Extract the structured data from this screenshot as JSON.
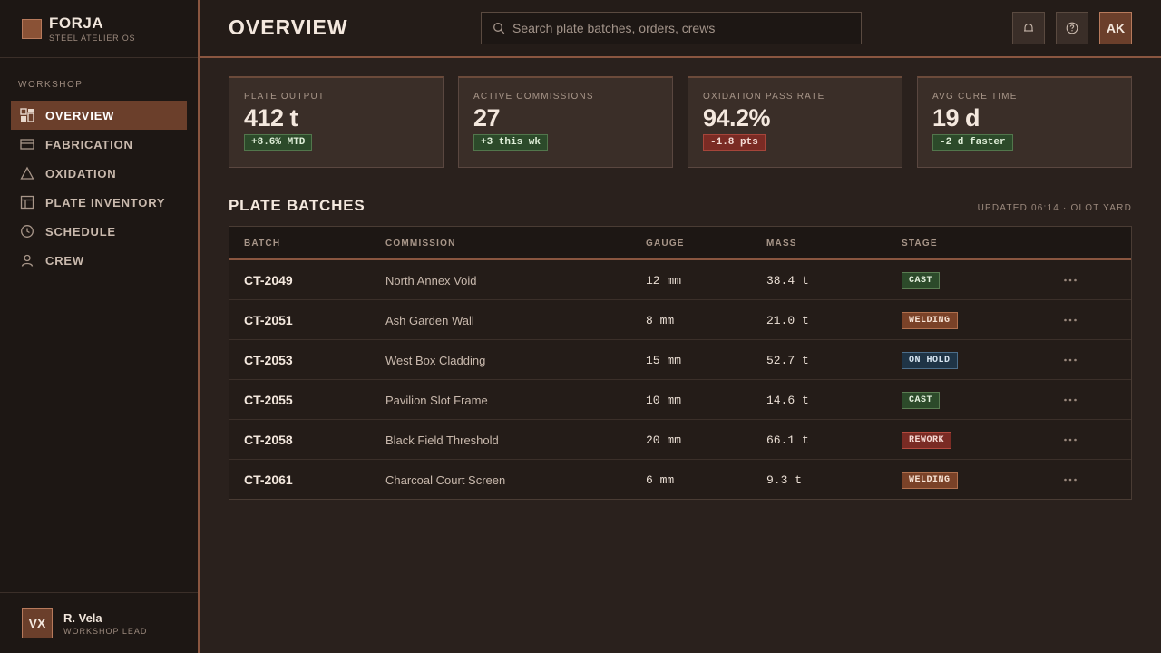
{
  "brand": {
    "name": "FORJA",
    "subtitle": "STEEL ATELIER OS"
  },
  "sidebar": {
    "section_label": "WORKSHOP",
    "items": [
      {
        "label": "OVERVIEW",
        "icon": "dashboard-icon",
        "active": true
      },
      {
        "label": "FABRICATION",
        "icon": "panel-icon",
        "active": false
      },
      {
        "label": "OXIDATION",
        "icon": "triangle-icon",
        "active": false
      },
      {
        "label": "PLATE INVENTORY",
        "icon": "layout-icon",
        "active": false
      },
      {
        "label": "SCHEDULE",
        "icon": "clock-icon",
        "active": false
      },
      {
        "label": "CREW",
        "icon": "user-icon",
        "active": false
      }
    ]
  },
  "user": {
    "initials": "VX",
    "name": "R. Vela",
    "role": "WORKSHOP LEAD"
  },
  "header": {
    "title": "OVERVIEW",
    "search_placeholder": "Search plate batches, orders, crews",
    "avatar_initials": "AK"
  },
  "kpis": [
    {
      "label": "PLATE OUTPUT",
      "value": "412 t",
      "delta": "+8.6% MTD",
      "tone": "pos"
    },
    {
      "label": "ACTIVE COMMISSIONS",
      "value": "27",
      "delta": "+3 this wk",
      "tone": "pos"
    },
    {
      "label": "OXIDATION PASS RATE",
      "value": "94.2%",
      "delta": "-1.8 pts",
      "tone": "neg"
    },
    {
      "label": "AVG CURE TIME",
      "value": "19 d",
      "delta": "-2 d faster",
      "tone": "pos"
    }
  ],
  "batches": {
    "title": "PLATE BATCHES",
    "meta": "UPDATED 06:14 · OLOT YARD",
    "columns": {
      "batch": "BATCH",
      "commission": "COMMISSION",
      "gauge": "GAUGE",
      "mass": "MASS",
      "stage": "STAGE"
    },
    "rows": [
      {
        "batch": "CT-2049",
        "commission": "North Annex Void",
        "gauge": "12 mm",
        "mass": "38.4 t",
        "stage": "CAST",
        "stage_kind": "cast"
      },
      {
        "batch": "CT-2051",
        "commission": "Ash Garden Wall",
        "gauge": "8 mm",
        "mass": "21.0 t",
        "stage": "WELDING",
        "stage_kind": "welding"
      },
      {
        "batch": "CT-2053",
        "commission": "West Box Cladding",
        "gauge": "15 mm",
        "mass": "52.7 t",
        "stage": "ON HOLD",
        "stage_kind": "hold"
      },
      {
        "batch": "CT-2055",
        "commission": "Pavilion Slot Frame",
        "gauge": "10 mm",
        "mass": "14.6 t",
        "stage": "CAST",
        "stage_kind": "cast"
      },
      {
        "batch": "CT-2058",
        "commission": "Black Field Threshold",
        "gauge": "20 mm",
        "mass": "66.1 t",
        "stage": "REWORK",
        "stage_kind": "rework"
      },
      {
        "batch": "CT-2061",
        "commission": "Charcoal Court Screen",
        "gauge": "6 mm",
        "mass": "9.3 t",
        "stage": "WELDING",
        "stage_kind": "welding"
      }
    ]
  },
  "colors": {
    "accent": "#8a5640",
    "active_nav": "#6b3f2b",
    "positive": "#2c4a2a",
    "negative": "#7a2b24"
  }
}
